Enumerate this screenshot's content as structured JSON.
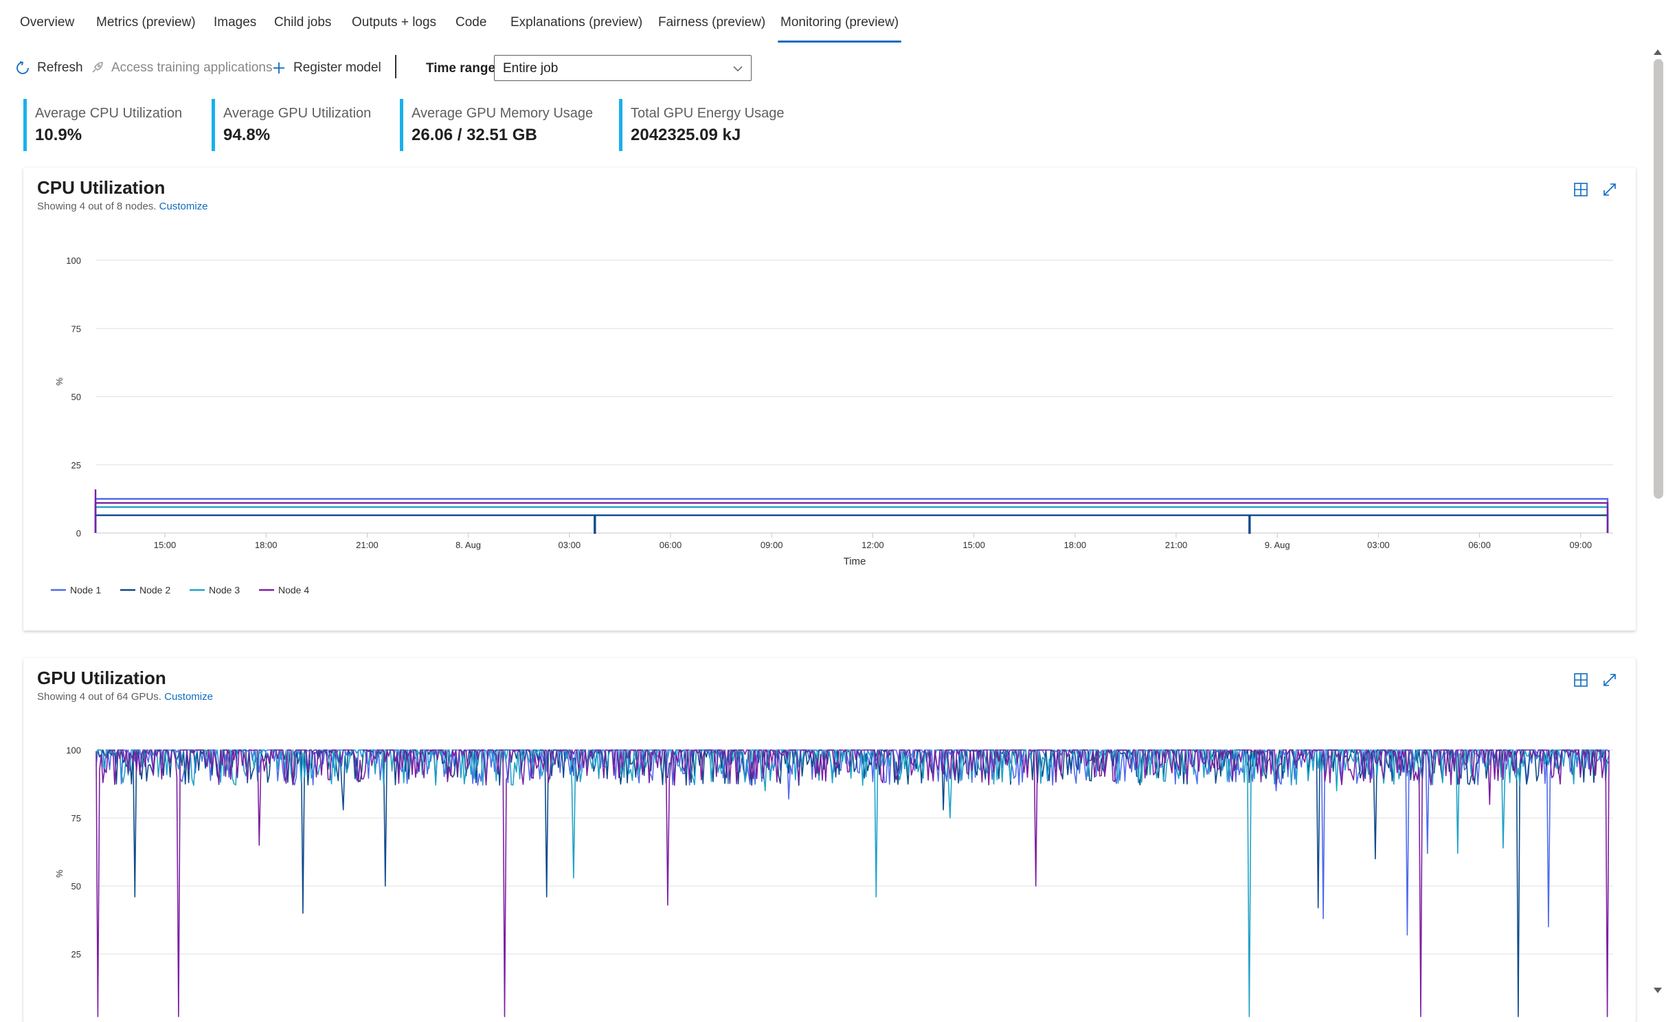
{
  "tabs": [
    {
      "label": "Overview"
    },
    {
      "label": "Metrics (preview)"
    },
    {
      "label": "Images"
    },
    {
      "label": "Child jobs"
    },
    {
      "label": "Outputs + logs"
    },
    {
      "label": "Code"
    },
    {
      "label": "Explanations (preview)"
    },
    {
      "label": "Fairness (preview)"
    },
    {
      "label": "Monitoring (preview)",
      "active": true
    }
  ],
  "toolbar": {
    "refresh_label": "Refresh",
    "access_label": "Access training applications",
    "register_label": "Register model",
    "time_range_label": "Time range",
    "time_range_value": "Entire job"
  },
  "metrics": [
    {
      "label": "Average CPU Utilization",
      "value": "10.9%"
    },
    {
      "label": "Average GPU Utilization",
      "value": "94.8%"
    },
    {
      "label": "Average GPU Memory Usage",
      "value": "26.06 / 32.51 GB"
    },
    {
      "label": "Total GPU Energy Usage",
      "value": "2042325.09 kJ"
    }
  ],
  "colors": {
    "accent": "#0f6cbd",
    "metric_bar": "#1ab0ec",
    "node1": "#4f6bed",
    "node2": "#0e4a8c",
    "node3": "#1fa2c8",
    "node4": "#7c1fa3"
  },
  "cpu_card": {
    "title": "CPU Utilization",
    "subtitle": "Showing 4 out of 8 nodes.",
    "customize": "Customize"
  },
  "gpu_card": {
    "title": "GPU Utilization",
    "subtitle": "Showing 4 out of 64 GPUs.",
    "customize": "Customize"
  },
  "chart_data": [
    {
      "type": "line",
      "title": "CPU Utilization",
      "xlabel": "Time",
      "ylabel": "%",
      "ylim": [
        0,
        100
      ],
      "yticks": [
        0,
        25,
        50,
        75,
        100
      ],
      "xticks": [
        "15:00",
        "18:00",
        "21:00",
        "8. Aug",
        "03:00",
        "06:00",
        "09:00",
        "12:00",
        "15:00",
        "18:00",
        "21:00",
        "9. Aug",
        "03:00",
        "06:00",
        "09:00"
      ],
      "grid": true,
      "legend": "bottom-left",
      "series": [
        {
          "name": "Node 1",
          "level": 12.5,
          "color": "#4f6bed"
        },
        {
          "name": "Node 2",
          "level": 6.5,
          "color": "#0e4a8c",
          "dips": [
            0.33,
            0.763
          ]
        },
        {
          "name": "Node 3",
          "level": 9.5,
          "color": "#1fa2c8"
        },
        {
          "name": "Node 4",
          "level": 11,
          "color": "#7c1fa3"
        }
      ]
    },
    {
      "type": "line",
      "title": "GPU Utilization",
      "ylabel": "%",
      "ylim": [
        0,
        100
      ],
      "yticks": [
        25,
        50,
        75,
        100
      ],
      "grid": true,
      "series": [
        {
          "color": "#4f6bed",
          "level": 93,
          "dips": [
            [
              0.458,
              82
            ],
            [
              0.78,
              85
            ],
            [
              0.811,
              38
            ],
            [
              0.867,
              32
            ],
            [
              0.88,
              62
            ],
            [
              0.96,
              35
            ]
          ]
        },
        {
          "color": "#0e4a8c",
          "dips": [
            [
              0.026,
              46
            ],
            [
              0.137,
              40
            ],
            [
              0.163,
              78
            ],
            [
              0.191,
              50
            ],
            [
              0.298,
              46
            ],
            [
              0.56,
              78
            ],
            [
              0.808,
              42
            ],
            [
              0.846,
              60
            ],
            [
              0.94,
              2
            ]
          ]
        },
        {
          "color": "#1fa2c8",
          "dips": [
            [
              0.316,
              53
            ],
            [
              0.442,
              85
            ],
            [
              0.516,
              46
            ],
            [
              0.565,
              75
            ],
            [
              0.761,
              88
            ],
            [
              0.762,
              2
            ],
            [
              0.82,
              85
            ],
            [
              0.9,
              62
            ],
            [
              0.93,
              64
            ]
          ]
        },
        {
          "color": "#7c1fa3",
          "dips": [
            [
              0.001,
              2
            ],
            [
              0.054,
              2
            ],
            [
              0.108,
              65
            ],
            [
              0.27,
              2
            ],
            [
              0.378,
              43
            ],
            [
              0.621,
              50
            ],
            [
              0.875,
              2
            ],
            [
              0.921,
              80
            ],
            [
              0.999,
              2
            ]
          ]
        }
      ]
    }
  ]
}
